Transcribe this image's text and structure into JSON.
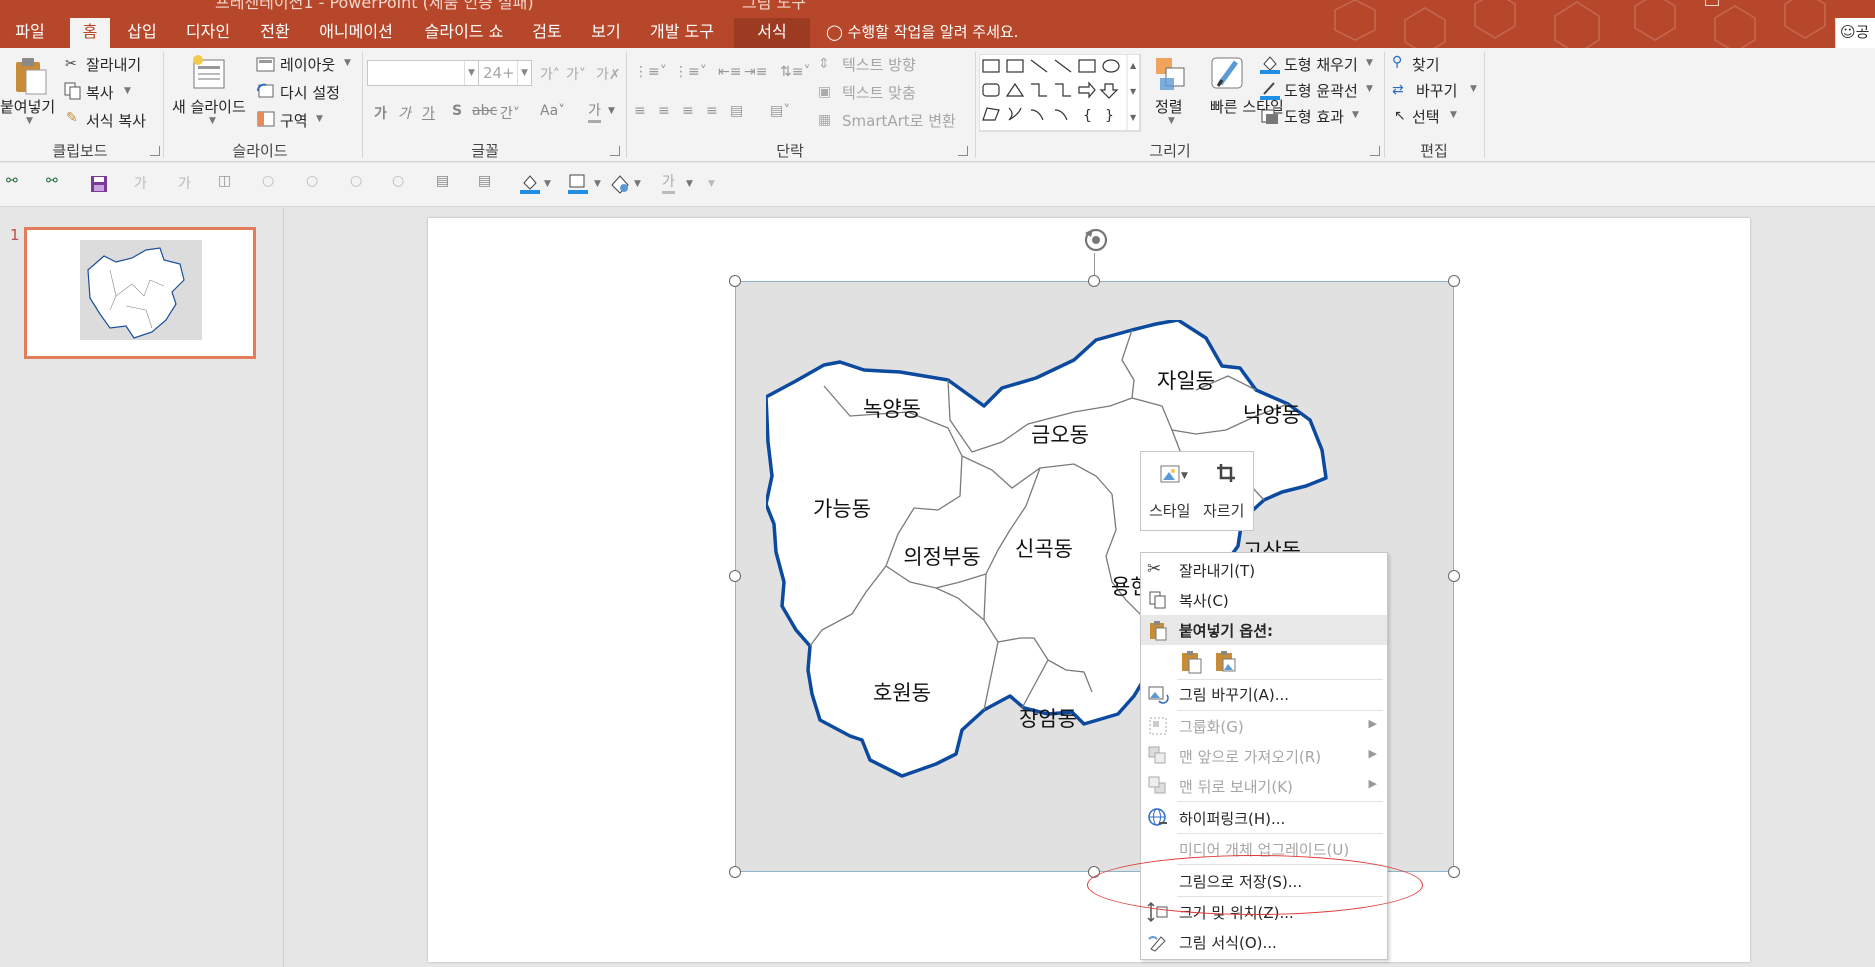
{
  "window": {
    "title_fragment": "프레젠테이션1 - PowerPoint (제품 인증 실패)",
    "tool_context": "그림 도구"
  },
  "tabs": [
    {
      "label": "파일"
    },
    {
      "label": "홈"
    },
    {
      "label": "삽입"
    },
    {
      "label": "디자인"
    },
    {
      "label": "전환"
    },
    {
      "label": "애니메이션"
    },
    {
      "label": "슬라이드 쇼"
    },
    {
      "label": "검토"
    },
    {
      "label": "보기"
    },
    {
      "label": "개발 도구"
    },
    {
      "label": "서식"
    }
  ],
  "tell_me": "수행할 작업을 알려 주세요.",
  "share": "공",
  "ribbon": {
    "clipboard": {
      "group": "클립보드",
      "paste": "붙여넣기",
      "cut": "잘라내기",
      "copy": "복사",
      "format_painter": "서식 복사"
    },
    "slides": {
      "group": "슬라이드",
      "new_slide": "새 슬라이드",
      "layout": "레이아웃",
      "reset": "다시 설정",
      "section": "구역"
    },
    "font": {
      "group": "글꼴",
      "font_name": "",
      "font_size": "24+"
    },
    "paragraph": {
      "group": "단락",
      "text_direction": "텍스트 방향",
      "align_text": "텍스트 맞춤",
      "smartart": "SmartArt로 변환"
    },
    "drawing": {
      "group": "그리기",
      "arrange": "정렬",
      "quick_styles": "빠른 스타일",
      "shape_fill": "도형 채우기",
      "shape_outline": "도형 윤곽선",
      "shape_effects": "도형 효과"
    },
    "editing": {
      "group": "편집",
      "find": "찾기",
      "replace": "바꾸기",
      "select": "선택"
    }
  },
  "thumbnail": {
    "number": "1"
  },
  "map_regions": [
    {
      "name": "녹양동"
    },
    {
      "name": "금오동"
    },
    {
      "name": "자일동"
    },
    {
      "name": "낙양동"
    },
    {
      "name": "가능동"
    },
    {
      "name": "의정부동"
    },
    {
      "name": "신곡동"
    },
    {
      "name": "용현동"
    },
    {
      "name": "고산동"
    },
    {
      "name": "호원동"
    },
    {
      "name": "장암동"
    }
  ],
  "mini_toolbar": {
    "style": "스타일",
    "crop": "자르기"
  },
  "context_menu": {
    "cut": "잘라내기(T)",
    "copy": "복사(C)",
    "paste_options": "붙여넣기 옵션:",
    "change_picture": "그림 바꾸기(A)...",
    "group": "그룹화(G)",
    "bring_front": "맨 앞으로 가져오기(R)",
    "send_back": "맨 뒤로 보내기(K)",
    "hyperlink": "하이퍼링크(H)...",
    "upgrade_media": "미디어 개체 업그레이드(U)",
    "save_as_picture": "그림으로 저장(S)...",
    "size_position": "크기 및 위치(Z)...",
    "format_picture": "그림 서식(O)..."
  },
  "colors": {
    "accent": "#b7472a",
    "map_border": "#0b4a9e",
    "annotation": "#e03b3b"
  }
}
